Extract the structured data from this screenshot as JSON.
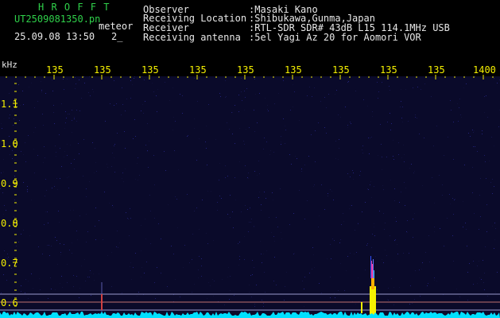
{
  "app_title": "H R O F F T",
  "file_name": "UT2509081350.pn",
  "mode_label": "meteor",
  "datetime": "25.09.08 13:50",
  "frame_index": "2_",
  "info_labels": [
    "Observer",
    "Receiving Location",
    "Receiver",
    "Receiving antenna"
  ],
  "info_values": [
    ":Masaki Kano",
    ":Shibukawa,Gunma,Japan",
    ":RTL-SDR SDR# 43dB L15 114.1MHz USB",
    ":5el Yagi Az 20 for Aomori VOR"
  ],
  "time_ticks": [
    "135",
    "135",
    "135",
    "135",
    "135",
    "135",
    "135",
    "135",
    "135",
    "1400"
  ],
  "freq_unit": "kHz",
  "freq_ticks": [
    "1.1",
    "1.0",
    "0.9",
    "0.8",
    "0.7",
    "0.6"
  ],
  "colors": {
    "label_green": "#2fd04a",
    "info_white": "#e8e8e8",
    "tick_yellow": "#f5f000",
    "background": "#0a0a2a",
    "spectrum_cyan": "#00e0ff"
  }
}
